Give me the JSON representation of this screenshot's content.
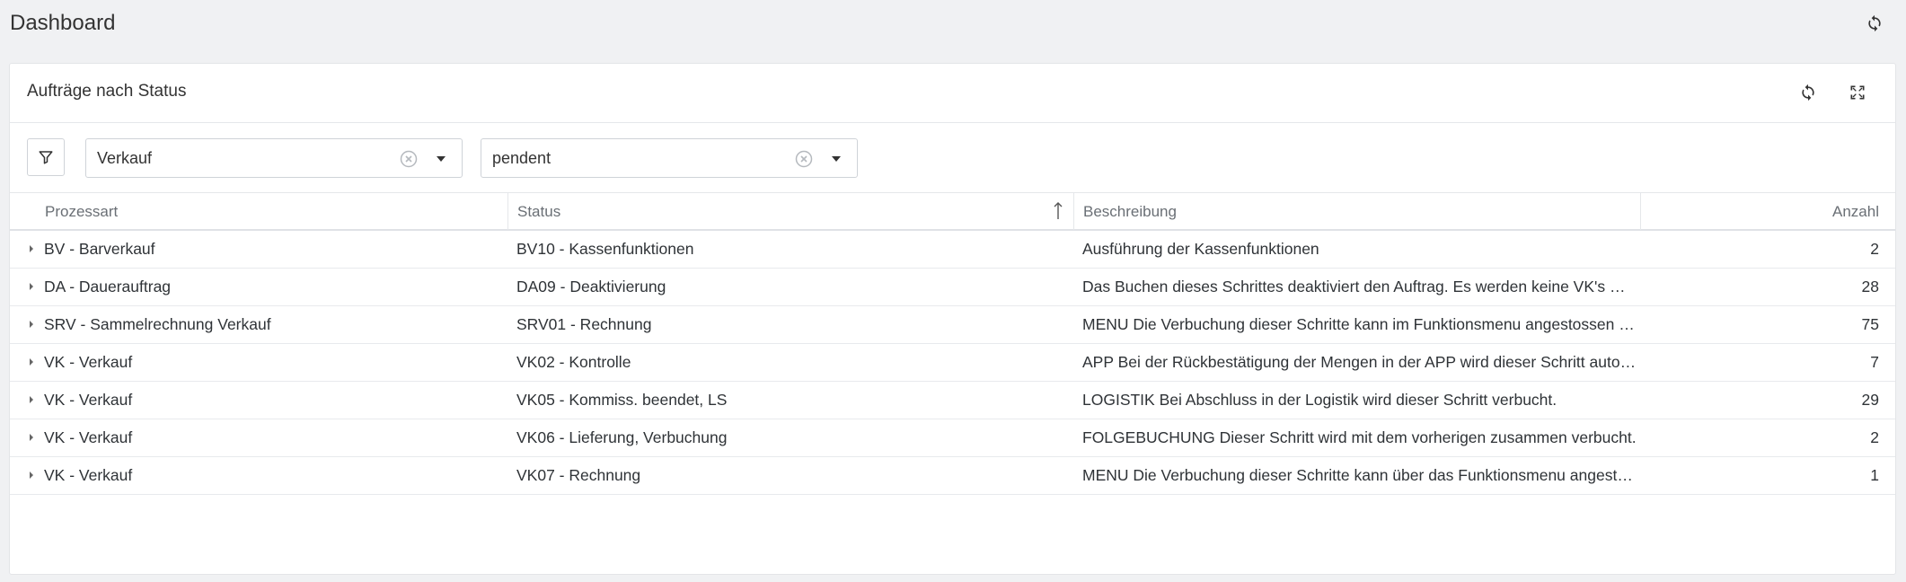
{
  "header": {
    "title": "Dashboard",
    "refresh_icon": "refresh-icon"
  },
  "panel": {
    "title": "Aufträge nach Status",
    "refresh_icon": "refresh-icon",
    "expand_icon": "fullscreen-icon"
  },
  "filters": {
    "filter_icon": "filter-icon",
    "process_select": {
      "value": "Verkauf"
    },
    "status_select": {
      "value": "pendent"
    }
  },
  "table": {
    "columns": [
      {
        "label": "Prozessart"
      },
      {
        "label": "Status",
        "sorted": "ascending"
      },
      {
        "label": "Beschreibung"
      },
      {
        "label": "Anzahl"
      }
    ],
    "rows": [
      {
        "process": "BV - Barverkauf",
        "status": "BV10 - Kassenfunktionen",
        "description": "Ausführung der Kassenfunktionen",
        "count": "2"
      },
      {
        "process": "DA - Dauerauftrag",
        "status": "DA09 - Deaktivierung",
        "description": "Das Buchen dieses Schrittes deaktiviert den Auftrag. Es werden keine VK's m…",
        "count": "28"
      },
      {
        "process": "SRV - Sammelrechnung Verkauf",
        "status": "SRV01 - Rechnung",
        "description": "MENU Die Verbuchung dieser Schritte kann im Funktionsmenu angestossen …",
        "count": "75"
      },
      {
        "process": "VK - Verkauf",
        "status": "VK02 - Kontrolle",
        "description": "APP Bei der Rückbestätigung der Mengen in der APP wird dieser Schritt auto…",
        "count": "7"
      },
      {
        "process": "VK - Verkauf",
        "status": "VK05 - Kommiss. beendet, LS",
        "description": "LOGISTIK Bei Abschluss in der Logistik wird dieser Schritt verbucht.",
        "count": "29"
      },
      {
        "process": "VK - Verkauf",
        "status": "VK06 - Lieferung, Verbuchung",
        "description": "FOLGEBUCHUNG Dieser Schritt wird mit dem vorherigen zusammen verbucht.",
        "count": "2"
      },
      {
        "process": "VK - Verkauf",
        "status": "VK07 - Rechnung",
        "description": "MENU Die Verbuchung dieser Schritte kann über das Funktionsmenu angesto…",
        "count": "1"
      }
    ]
  }
}
